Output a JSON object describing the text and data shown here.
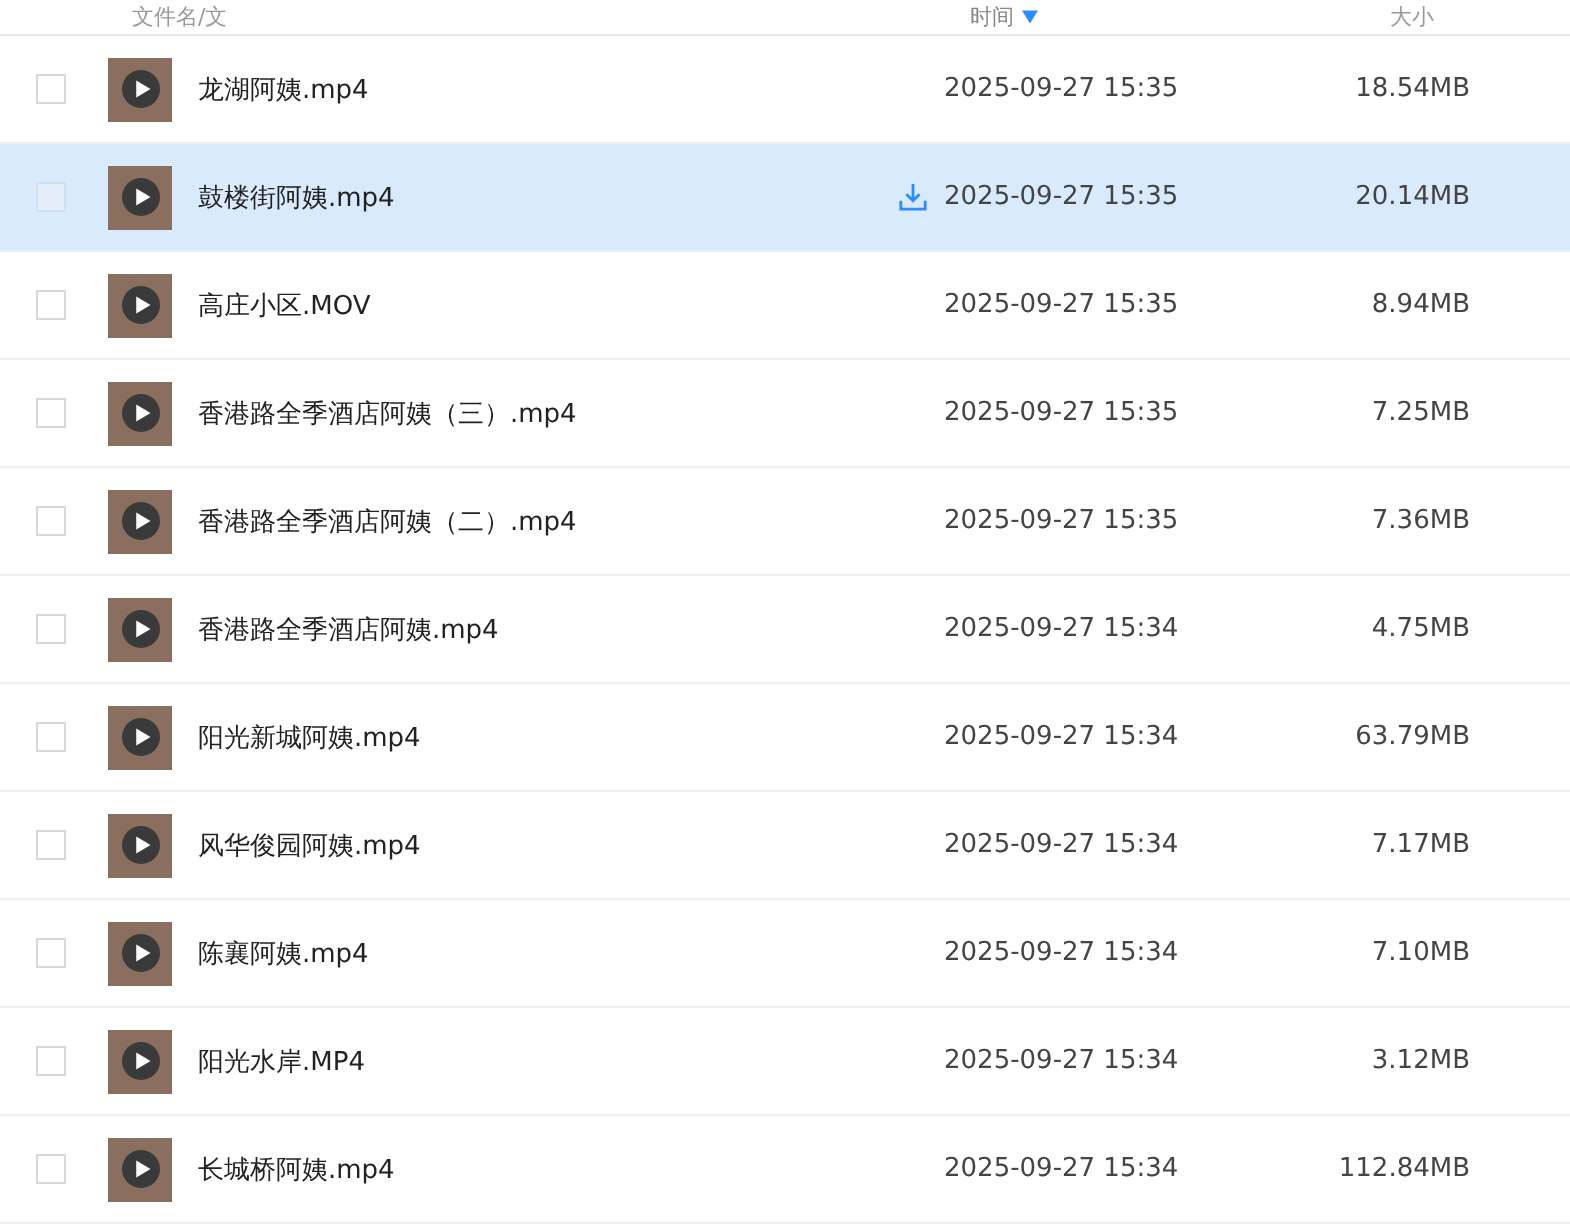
{
  "header": {
    "columns": [
      {
        "label": "文件名/文",
        "sorted": false
      },
      {
        "label": "时间",
        "sorted": true
      },
      {
        "label": "大小",
        "sorted": false
      }
    ]
  },
  "files": [
    {
      "name": "龙湖阿姨.mp4",
      "time": "2025-09-27 15:35",
      "size": "18.54MB",
      "selected": false,
      "checked": false
    },
    {
      "name": "鼓楼街阿姨.mp4",
      "time": "2025-09-27 15:35",
      "size": "20.14MB",
      "selected": true,
      "checked": false
    },
    {
      "name": "高庄小区.MOV",
      "time": "2025-09-27 15:35",
      "size": "8.94MB",
      "selected": false,
      "checked": false
    },
    {
      "name": "香港路全季酒店阿姨（三）.mp4",
      "time": "2025-09-27 15:35",
      "size": "7.25MB",
      "selected": false,
      "checked": false
    },
    {
      "name": "香港路全季酒店阿姨（二）.mp4",
      "time": "2025-09-27 15:35",
      "size": "7.36MB",
      "selected": false,
      "checked": false
    },
    {
      "name": "香港路全季酒店阿姨.mp4",
      "time": "2025-09-27 15:34",
      "size": "4.75MB",
      "selected": false,
      "checked": false
    },
    {
      "name": "阳光新城阿姨.mp4",
      "time": "2025-09-27 15:34",
      "size": "63.79MB",
      "selected": false,
      "checked": false
    },
    {
      "name": "风华俊园阿姨.mp4",
      "time": "2025-09-27 15:34",
      "size": "7.17MB",
      "selected": false,
      "checked": false
    },
    {
      "name": "陈襄阿姨.mp4",
      "time": "2025-09-27 15:34",
      "size": "7.10MB",
      "selected": false,
      "checked": false
    },
    {
      "name": "阳光水岸.MP4",
      "time": "2025-09-27 15:34",
      "size": "3.12MB",
      "selected": false,
      "checked": false
    },
    {
      "name": "长城桥阿姨.mp4",
      "time": "2025-09-27 15:34",
      "size": "112.84MB",
      "selected": false,
      "checked": false
    }
  ]
}
